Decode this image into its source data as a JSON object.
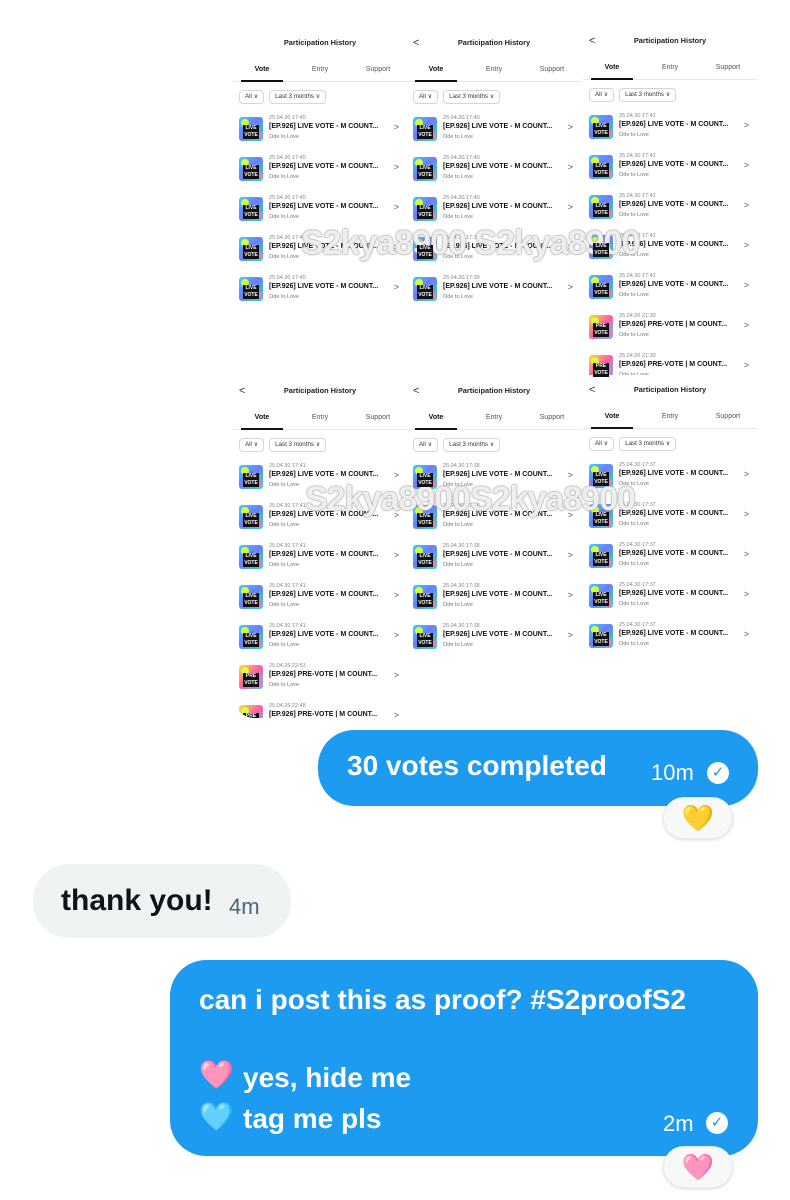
{
  "collage": {
    "header_title": "Participation History",
    "back_glyph": "<",
    "tabs": [
      "Vote",
      "Entry",
      "Support"
    ],
    "filter_all": "All",
    "filter_period": "Last 3 months",
    "subtitle": "Ode to Love",
    "chevron": ">",
    "watermark_top": "S2kya8900 S2kya8900",
    "watermark_bottom": "S2kya8900S2kya8900",
    "live_thumb_text": "LIVE VOTE",
    "pre_thumb_text": "PRE VOTE",
    "panels": [
      {
        "rows": [
          {
            "date": "25.04.30 17:40",
            "title": "[EP.926] LIVE VOTE - M COUNT...",
            "kind": "live"
          },
          {
            "date": "25.04.30 17:40",
            "title": "[EP.926] LIVE VOTE - M COUNT...",
            "kind": "live"
          },
          {
            "date": "25.04.30 17:40",
            "title": "[EP.926] LIVE VOTE - M COUNT...",
            "kind": "live"
          },
          {
            "date": "25.04.30 17:40",
            "title": "[EP.926] LIVE VOTE - M COUNT...",
            "kind": "live"
          },
          {
            "date": "25.04.30 17:40",
            "title": "[EP.926] LIVE VOTE - M COUNT...",
            "kind": "live"
          }
        ]
      },
      {
        "rows": [
          {
            "date": "25.04.30 17:40",
            "title": "[EP.926] LIVE VOTE - M COUNT...",
            "kind": "live"
          },
          {
            "date": "25.04.30 17:40",
            "title": "[EP.926] LIVE VOTE - M COUNT...",
            "kind": "live"
          },
          {
            "date": "25.04.30 17:40",
            "title": "[EP.926] LIVE VOTE - M COUNT...",
            "kind": "live"
          },
          {
            "date": "25.04.30 17:39",
            "title": "[EP.926] LIVE VOTE - M COUNT...",
            "kind": "live"
          },
          {
            "date": "25.04.30 17:39",
            "title": "[EP.926] LIVE VOTE - M COUNT...",
            "kind": "live"
          }
        ]
      },
      {
        "rows": [
          {
            "date": "25.04.30 17:42",
            "title": "[EP.926] LIVE VOTE - M COUNT...",
            "kind": "live"
          },
          {
            "date": "25.04.30 17:42",
            "title": "[EP.926] LIVE VOTE - M COUNT...",
            "kind": "live"
          },
          {
            "date": "25.04.30 17:42",
            "title": "[EP.926] LIVE VOTE - M COUNT...",
            "kind": "live"
          },
          {
            "date": "25.04.30 17:42",
            "title": "[EP.926] LIVE VOTE - M COUNT...",
            "kind": "live"
          },
          {
            "date": "25.04.30 17:42",
            "title": "[EP.926] LIVE VOTE - M COUNT...",
            "kind": "live"
          },
          {
            "date": "25.04.26 21:30",
            "title": "[EP.926] PRE-VOTE | M COUNT...",
            "kind": "pre"
          },
          {
            "date": "25.04.26 21:30",
            "title": "[EP.926] PRE-VOTE | M COUNT...",
            "kind": "pre"
          }
        ]
      },
      {
        "rows": [
          {
            "date": "25.04.30 17:41",
            "title": "[EP.926] LIVE VOTE - M COUNT...",
            "kind": "live"
          },
          {
            "date": "25.04.30 17:41",
            "title": "[EP.926] LIVE VOTE - M COUNT...",
            "kind": "live"
          },
          {
            "date": "25.04.30 17:41",
            "title": "[EP.926] LIVE VOTE - M COUNT...",
            "kind": "live"
          },
          {
            "date": "25.04.30 17:41",
            "title": "[EP.926] LIVE VOTE - M COUNT...",
            "kind": "live"
          },
          {
            "date": "25.04.30 17:41",
            "title": "[EP.926] LIVE VOTE - M COUNT...",
            "kind": "live"
          },
          {
            "date": "25.04.26 22:53",
            "title": "[EP.926] PRE-VOTE | M COUNT...",
            "kind": "pre"
          },
          {
            "date": "25.04.26 22:48",
            "title": "[EP.926] PRE-VOTE | M COUNT...",
            "kind": "pre"
          }
        ]
      },
      {
        "rows": [
          {
            "date": "25.04.30 17:38",
            "title": "[EP.926] LIVE VOTE - M COUNT...",
            "kind": "live"
          },
          {
            "date": "25.04.30 17:38",
            "title": "[EP.926] LIVE VOTE - M COUNT...",
            "kind": "live"
          },
          {
            "date": "25.04.30 17:38",
            "title": "[EP.926] LIVE VOTE - M COUNT...",
            "kind": "live"
          },
          {
            "date": "25.04.30 17:38",
            "title": "[EP.926] LIVE VOTE - M COUNT...",
            "kind": "live"
          },
          {
            "date": "25.04.30 17:38",
            "title": "[EP.926] LIVE VOTE - M COUNT...",
            "kind": "live"
          }
        ]
      },
      {
        "rows": [
          {
            "date": "25.04.30 17:37",
            "title": "[EP.926] LIVE VOTE - M COUNT...",
            "kind": "live"
          },
          {
            "date": "25.04.30 17:37",
            "title": "[EP.926] LIVE VOTE - M COUNT...",
            "kind": "live"
          },
          {
            "date": "25.04.30 17:37",
            "title": "[EP.926] LIVE VOTE - M COUNT...",
            "kind": "live"
          },
          {
            "date": "25.04.30 17:37",
            "title": "[EP.926] LIVE VOTE - M COUNT...",
            "kind": "live"
          },
          {
            "date": "25.04.30 17:37",
            "title": "[EP.926] LIVE VOTE - M COUNT...",
            "kind": "live"
          }
        ]
      }
    ]
  },
  "messages": [
    {
      "text": "30 votes completed",
      "time": "10m",
      "reaction": "💛"
    },
    {
      "text": "thank you!",
      "time": "4m"
    },
    {
      "line1": "can i post this as proof? #S2proofS2",
      "heart1": "🩷",
      "line2": "yes, hide me",
      "heart2": "🩵",
      "line3": "tag me pls",
      "time": "2m",
      "reaction": "🩷"
    }
  ],
  "check_glyph": "✓",
  "colors": {
    "sent_bubble": "#1d9bf0",
    "received_bubble": "#eff3f4"
  }
}
